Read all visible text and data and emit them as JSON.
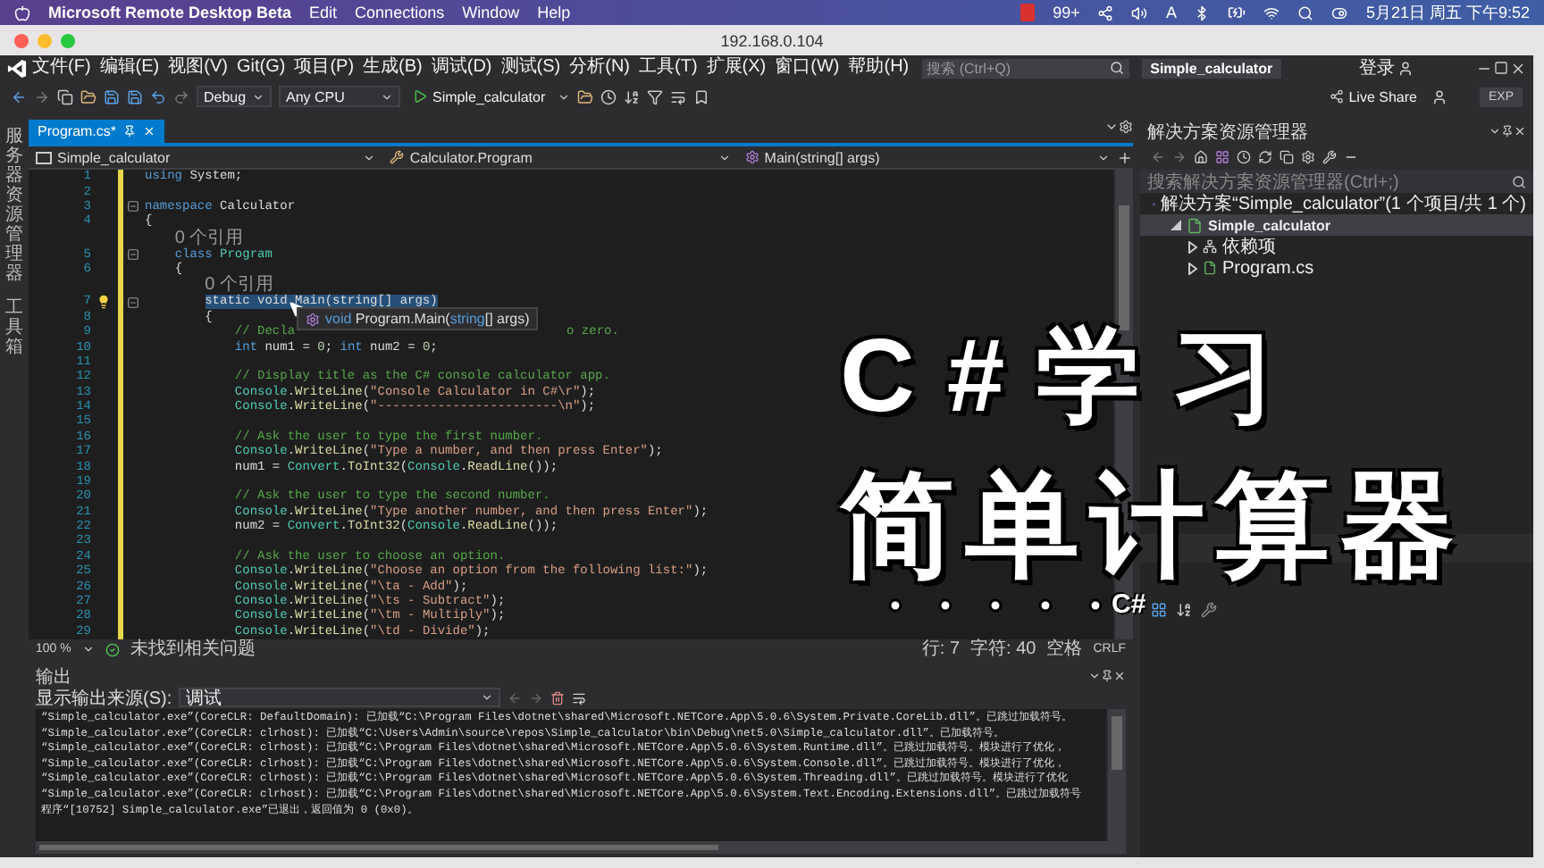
{
  "mac_menu_bar": {
    "app": "Microsoft Remote Desktop Beta",
    "menus": [
      "Edit",
      "Connections",
      "Window",
      "Help"
    ],
    "notification_count": "99+",
    "input_source": "A",
    "clock": "5月21日 周五 下午9:52"
  },
  "window": {
    "title": "192.168.0.104"
  },
  "vs_menu": [
    "文件(F)",
    "编辑(E)",
    "视图(V)",
    "Git(G)",
    "项目(P)",
    "生成(B)",
    "调试(D)",
    "测试(S)",
    "分析(N)",
    "工具(T)",
    "扩展(X)",
    "窗口(W)",
    "帮助(H)"
  ],
  "search": {
    "placeholder": "搜索 (Ctrl+Q)"
  },
  "solution_name": "Simple_calculator",
  "sign_in": "登录",
  "toolbar": {
    "configuration": "Debug",
    "platform": "Any CPU",
    "run_target": "Simple_calculator",
    "live_share": "Live Share",
    "badge": "EXP"
  },
  "side_strip": [
    "服务器资源管理器",
    "工具箱"
  ],
  "editor": {
    "tabs": [
      {
        "label": "Program.cs*",
        "selected": true
      }
    ],
    "nav": [
      "Simple_calculator",
      "Calculator.Program",
      "Main(string[] args)"
    ],
    "lines": [
      {
        "kind": "code",
        "number": "1",
        "fold": false,
        "bulb": false,
        "tokens": [
          {
            "kind": "kw",
            "text": "using"
          },
          {
            "kind": "plain",
            "text": " System;"
          }
        ]
      },
      {
        "kind": "code",
        "number": "2",
        "fold": false,
        "bulb": false
      },
      {
        "kind": "code",
        "number": "3",
        "fold": true,
        "bulb": false,
        "tokens": [
          {
            "kind": "kw",
            "text": "namespace"
          },
          {
            "kind": "plain",
            "text": " Calculator"
          }
        ]
      },
      {
        "kind": "code",
        "number": "4",
        "fold": false,
        "bulb": false,
        "tokens": [
          {
            "kind": "plain",
            "text": "{"
          }
        ]
      },
      {
        "kind": "codelens",
        "text": "    0 个引用"
      },
      {
        "kind": "code",
        "number": "5",
        "fold": true,
        "bulb": false,
        "tokens": [
          {
            "kind": "kw",
            "text": "    class"
          },
          {
            "kind": "type",
            "text": " Program"
          }
        ]
      },
      {
        "kind": "code",
        "number": "6",
        "fold": false,
        "bulb": false,
        "tokens": [
          {
            "kind": "plain",
            "text": "    {"
          }
        ]
      },
      {
        "kind": "codelens",
        "text": "        0 个引用"
      },
      {
        "kind": "code",
        "number": "7",
        "fold": true,
        "bulb": true,
        "tokens": [
          {
            "kind": "sel",
            "text": "        static void Main(string[] args)"
          }
        ]
      },
      {
        "kind": "code",
        "number": "8",
        "fold": false,
        "bulb": false,
        "tokens": [
          {
            "kind": "plain",
            "text": "        {"
          }
        ]
      },
      {
        "kind": "code",
        "number": "9",
        "fold": false,
        "bulb": false,
        "tokens": [
          {
            "kind": "com",
            "text": "            // Decla"
          },
          {
            "kind": "gap"
          },
          {
            "kind": "com",
            "text": "o zero."
          }
        ]
      },
      {
        "kind": "code",
        "number": "10",
        "fold": false,
        "bulb": false,
        "tokens": [
          {
            "kind": "kw",
            "text": "            int"
          },
          {
            "kind": "plain",
            "text": " num1 = "
          },
          {
            "kind": "num",
            "text": "0"
          },
          {
            "kind": "plain",
            "text": "; "
          },
          {
            "kind": "kw",
            "text": "int"
          },
          {
            "kind": "plain",
            "text": " num2 = "
          },
          {
            "kind": "num",
            "text": "0"
          },
          {
            "kind": "plain",
            "text": ";"
          }
        ]
      },
      {
        "kind": "code",
        "number": "11",
        "fold": false,
        "bulb": false
      },
      {
        "kind": "code",
        "number": "12",
        "fold": false,
        "bulb": false,
        "tokens": [
          {
            "kind": "com",
            "text": "            // Display title as the C# console calculator app."
          }
        ]
      },
      {
        "kind": "code",
        "number": "13",
        "fold": false,
        "bulb": false,
        "tokens": [
          {
            "kind": "type",
            "text": "            Console"
          },
          {
            "kind": "plain",
            "text": "."
          },
          {
            "kind": "method",
            "text": "WriteLine"
          },
          {
            "kind": "plain",
            "text": "("
          },
          {
            "kind": "str",
            "text": "\"Console Calculator in C#\\r\""
          },
          {
            "kind": "plain",
            "text": ");"
          }
        ]
      },
      {
        "kind": "code",
        "number": "14",
        "fold": false,
        "bulb": false,
        "tokens": [
          {
            "kind": "type",
            "text": "            Console"
          },
          {
            "kind": "plain",
            "text": "."
          },
          {
            "kind": "method",
            "text": "WriteLine"
          },
          {
            "kind": "plain",
            "text": "("
          },
          {
            "kind": "str",
            "text": "\"------------------------\\n\""
          },
          {
            "kind": "plain",
            "text": ");"
          }
        ]
      },
      {
        "kind": "code",
        "number": "15",
        "fold": false,
        "bulb": false
      },
      {
        "kind": "code",
        "number": "16",
        "fold": false,
        "bulb": false,
        "tokens": [
          {
            "kind": "com",
            "text": "            // Ask the user to type the first number."
          }
        ]
      },
      {
        "kind": "code",
        "number": "17",
        "fold": false,
        "bulb": false,
        "tokens": [
          {
            "kind": "type",
            "text": "            Console"
          },
          {
            "kind": "plain",
            "text": "."
          },
          {
            "kind": "method",
            "text": "WriteLine"
          },
          {
            "kind": "plain",
            "text": "("
          },
          {
            "kind": "str",
            "text": "\"Type a number, and then press Enter\""
          },
          {
            "kind": "plain",
            "text": ");"
          }
        ]
      },
      {
        "kind": "code",
        "number": "18",
        "fold": false,
        "bulb": false,
        "tokens": [
          {
            "kind": "plain",
            "text": "            num1 = "
          },
          {
            "kind": "type",
            "text": "Convert"
          },
          {
            "kind": "plain",
            "text": "."
          },
          {
            "kind": "method",
            "text": "ToInt32"
          },
          {
            "kind": "plain",
            "text": "("
          },
          {
            "kind": "type",
            "text": "Console"
          },
          {
            "kind": "plain",
            "text": "."
          },
          {
            "kind": "method",
            "text": "ReadLine"
          },
          {
            "kind": "plain",
            "text": "());"
          }
        ]
      },
      {
        "kind": "code",
        "number": "19",
        "fold": false,
        "bulb": false
      },
      {
        "kind": "code",
        "number": "20",
        "fold": false,
        "bulb": false,
        "tokens": [
          {
            "kind": "com",
            "text": "            // Ask the user to type the second number."
          }
        ]
      },
      {
        "kind": "code",
        "number": "21",
        "fold": false,
        "bulb": false,
        "tokens": [
          {
            "kind": "type",
            "text": "            Console"
          },
          {
            "kind": "plain",
            "text": "."
          },
          {
            "kind": "method",
            "text": "WriteLine"
          },
          {
            "kind": "plain",
            "text": "("
          },
          {
            "kind": "str",
            "text": "\"Type another number, and then press Enter\""
          },
          {
            "kind": "plain",
            "text": ");"
          }
        ]
      },
      {
        "kind": "code",
        "number": "22",
        "fold": false,
        "bulb": false,
        "tokens": [
          {
            "kind": "plain",
            "text": "            num2 = "
          },
          {
            "kind": "type",
            "text": "Convert"
          },
          {
            "kind": "plain",
            "text": "."
          },
          {
            "kind": "method",
            "text": "ToInt32"
          },
          {
            "kind": "plain",
            "text": "("
          },
          {
            "kind": "type",
            "text": "Console"
          },
          {
            "kind": "plain",
            "text": "."
          },
          {
            "kind": "method",
            "text": "ReadLine"
          },
          {
            "kind": "plain",
            "text": "());"
          }
        ]
      },
      {
        "kind": "code",
        "number": "23",
        "fold": false,
        "bulb": false
      },
      {
        "kind": "code",
        "number": "24",
        "fold": false,
        "bulb": false,
        "tokens": [
          {
            "kind": "com",
            "text": "            // Ask the user to choose an option."
          }
        ]
      },
      {
        "kind": "code",
        "number": "25",
        "fold": false,
        "bulb": false,
        "tokens": [
          {
            "kind": "type",
            "text": "            Console"
          },
          {
            "kind": "plain",
            "text": "."
          },
          {
            "kind": "method",
            "text": "WriteLine"
          },
          {
            "kind": "plain",
            "text": "("
          },
          {
            "kind": "str",
            "text": "\"Choose an option from the following list:\""
          },
          {
            "kind": "plain",
            "text": ");"
          }
        ]
      },
      {
        "kind": "code",
        "number": "26",
        "fold": false,
        "bulb": false,
        "tokens": [
          {
            "kind": "type",
            "text": "            Console"
          },
          {
            "kind": "plain",
            "text": "."
          },
          {
            "kind": "method",
            "text": "WriteLine"
          },
          {
            "kind": "plain",
            "text": "("
          },
          {
            "kind": "str",
            "text": "\"\\ta - Add\""
          },
          {
            "kind": "plain",
            "text": ");"
          }
        ]
      },
      {
        "kind": "code",
        "number": "27",
        "fold": false,
        "bulb": false,
        "tokens": [
          {
            "kind": "type",
            "text": "            Console"
          },
          {
            "kind": "plain",
            "text": "."
          },
          {
            "kind": "method",
            "text": "WriteLine"
          },
          {
            "kind": "plain",
            "text": "("
          },
          {
            "kind": "str",
            "text": "\"\\ts - Subtract\""
          },
          {
            "kind": "plain",
            "text": ");"
          }
        ]
      },
      {
        "kind": "code",
        "number": "28",
        "fold": false,
        "bulb": false,
        "tokens": [
          {
            "kind": "type",
            "text": "            Console"
          },
          {
            "kind": "plain",
            "text": "."
          },
          {
            "kind": "method",
            "text": "WriteLine"
          },
          {
            "kind": "plain",
            "text": "("
          },
          {
            "kind": "str",
            "text": "\"\\tm - Multiply\""
          },
          {
            "kind": "plain",
            "text": ");"
          }
        ]
      },
      {
        "kind": "code",
        "number": "29",
        "fold": false,
        "bulb": false,
        "tokens": [
          {
            "kind": "type",
            "text": "            Console"
          },
          {
            "kind": "plain",
            "text": "."
          },
          {
            "kind": "method",
            "text": "WriteLine"
          },
          {
            "kind": "plain",
            "text": "("
          },
          {
            "kind": "str",
            "text": "\"\\td - Divide\""
          },
          {
            "kind": "plain",
            "text": ");"
          }
        ]
      }
    ],
    "tooltip": [
      {
        "kind": "kw",
        "text": "void"
      },
      {
        "kind": "plain",
        "text": " Program.Main("
      },
      {
        "kind": "kw",
        "text": "string"
      },
      {
        "kind": "plain",
        "text": "[] args)"
      }
    ],
    "status": {
      "zoom": "100 %",
      "issues": "未找到相关问题",
      "line": "行: 7",
      "char": "字符: 40",
      "spacing": "空格",
      "eol": "CRLF"
    }
  },
  "output": {
    "title": "输出",
    "source_label": "显示输出来源(S):",
    "source": "调试",
    "lines": [
      "“Simple_calculator.exe”(CoreCLR: DefaultDomain): 已加载“C:\\Program Files\\dotnet\\shared\\Microsoft.NETCore.App\\5.0.6\\System.Private.CoreLib.dll”。已跳过加载符号。",
      "“Simple_calculator.exe”(CoreCLR: clrhost): 已加载“C:\\Users\\Admin\\source\\repos\\Simple_calculator\\bin\\Debug\\net5.0\\Simple_calculator.dll”。已加载符号。",
      "“Simple_calculator.exe”(CoreCLR: clrhost): 已加载“C:\\Program Files\\dotnet\\shared\\Microsoft.NETCore.App\\5.0.6\\System.Runtime.dll”。已跳过加载符号。模块进行了优化，",
      "“Simple_calculator.exe”(CoreCLR: clrhost): 已加载“C:\\Program Files\\dotnet\\shared\\Microsoft.NETCore.App\\5.0.6\\System.Console.dll”。已跳过加载符号。模块进行了优化，",
      "“Simple_calculator.exe”(CoreCLR: clrhost): 已加载“C:\\Program Files\\dotnet\\shared\\Microsoft.NETCore.App\\5.0.6\\System.Threading.dll”。已跳过加载符号。模块进行了优化",
      "“Simple_calculator.exe”(CoreCLR: clrhost): 已加载“C:\\Program Files\\dotnet\\shared\\Microsoft.NETCore.App\\5.0.6\\System.Text.Encoding.Extensions.dll”。已跳过加载符号",
      "程序“[10752] Simple_calculator.exe”已退出，返回值为 0 (0x0)。"
    ]
  },
  "solution_explorer": {
    "title": "解决方案资源管理器",
    "search": {
      "placeholder": "搜索解决方案资源管理器(Ctrl+;)"
    },
    "tree": [
      {
        "kind": "solution",
        "label": "解决方案“Simple_calculator”(1 个项目/共 1 个)",
        "selected": false,
        "children": [
          {
            "kind": "project",
            "label": "Simple_calculator",
            "selected": true,
            "expanded": true,
            "children": [
              {
                "kind": "dependencies",
                "label": "依赖项",
                "selected": false,
                "expanded": false
              },
              {
                "kind": "file",
                "label": "Program.cs",
                "selected": false,
                "expanded": false
              }
            ]
          }
        ]
      }
    ]
  },
  "overlay": {
    "title": "C#学习",
    "subtitle": "简单计算器",
    "tag": "C#"
  }
}
